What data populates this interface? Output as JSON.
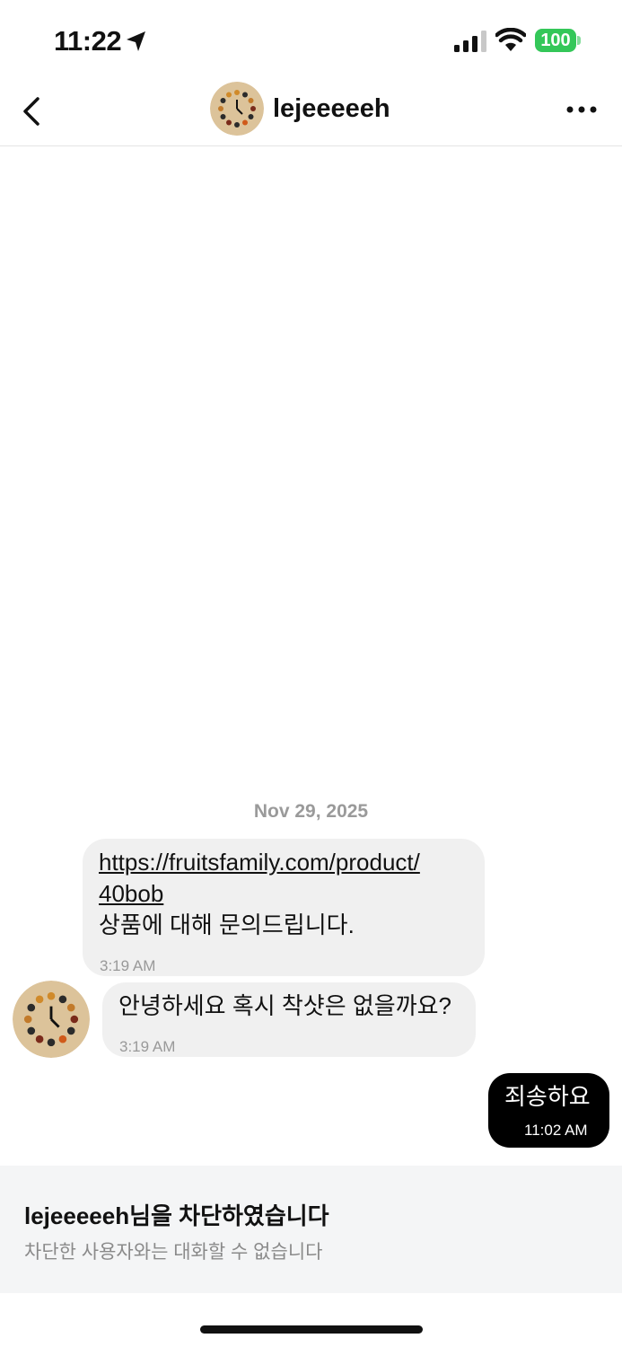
{
  "status_bar": {
    "time": "11:22",
    "battery": "100",
    "battery_color": "#34c759"
  },
  "header": {
    "username": "lejeeeeeh",
    "back_icon": "chevron-left-icon",
    "more_icon": "more-horizontal-icon"
  },
  "chat": {
    "date": "Nov 29, 2025",
    "messages": [
      {
        "direction": "incoming",
        "link_line1": "https://fruitsfamily.com/product/",
        "link_line2": "40bob",
        "text": "상품에 대해 문의드립니다.",
        "time": "3:19 AM"
      },
      {
        "direction": "incoming",
        "text": "안녕하세요 혹시 착샷은 없을까요?",
        "time": "3:19 AM"
      },
      {
        "direction": "outgoing",
        "text": "죄송하요",
        "time": "11:02 AM"
      }
    ]
  },
  "blocked": {
    "title": "lejeeeeeh님을 차단하였습니다",
    "subtitle": "차단한 사용자와는 대화할 수 없습니다"
  }
}
